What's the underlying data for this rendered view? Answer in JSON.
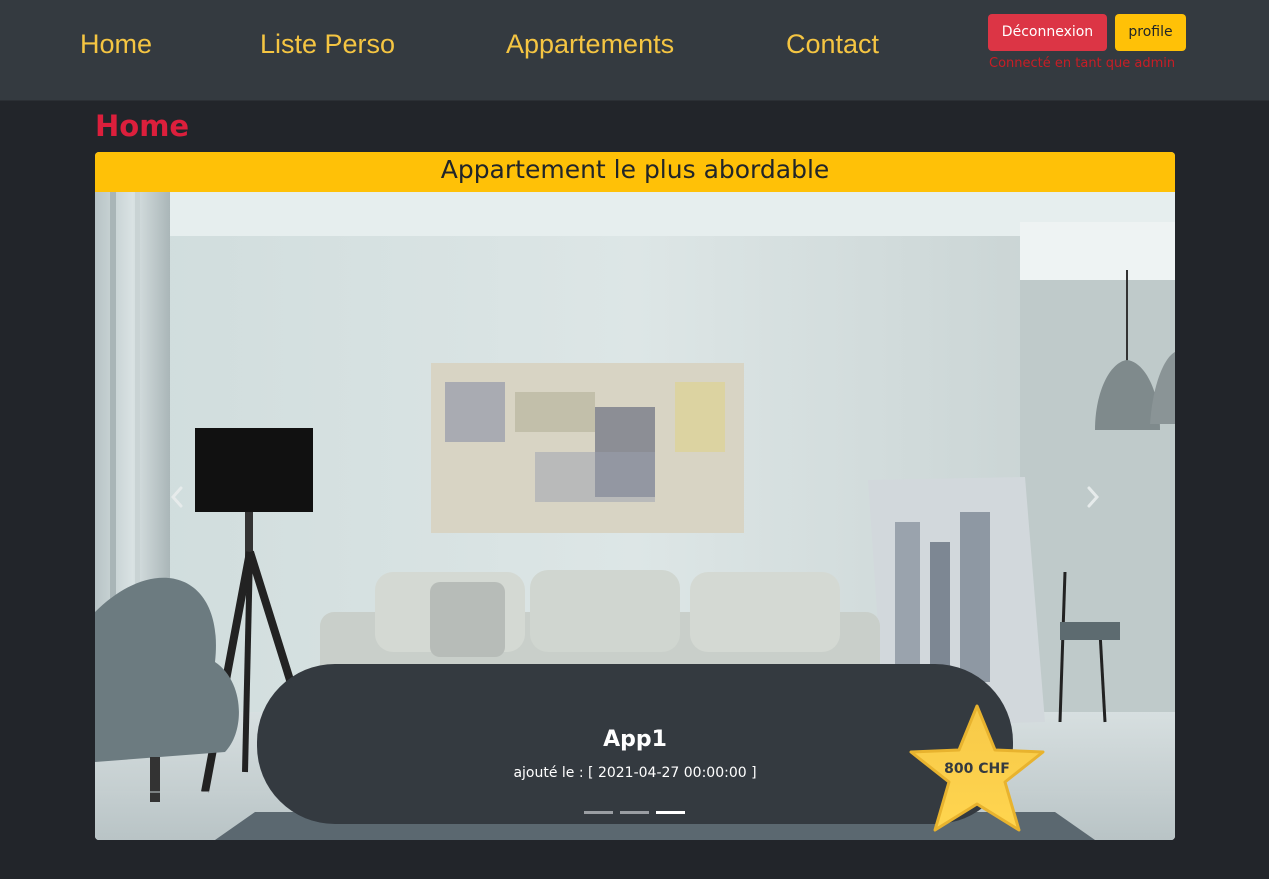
{
  "nav": {
    "links": [
      "Home",
      "Liste Perso",
      "Appartements",
      "Contact"
    ],
    "logout_label": "Déconnexion",
    "profile_label": "profile",
    "status_text": "Connecté en tant que admin"
  },
  "page": {
    "title": "Home"
  },
  "card": {
    "header": "Appartement le plus abordable"
  },
  "carousel": {
    "title": "App1",
    "added_text": "ajouté le : [ 2021-04-27 00:00:00 ]",
    "price": "800 CHF",
    "active_slide": 3,
    "slide_count": 3
  },
  "colors": {
    "navbar_bg": "#343a40",
    "page_bg": "#22252a",
    "nav_link": "#f5c542",
    "accent_red": "#dc3545",
    "accent_yellow": "#ffc107",
    "title_red": "#dc1f3c"
  },
  "icons": [
    "chevron-left-icon",
    "chevron-right-icon",
    "star-badge-icon"
  ]
}
